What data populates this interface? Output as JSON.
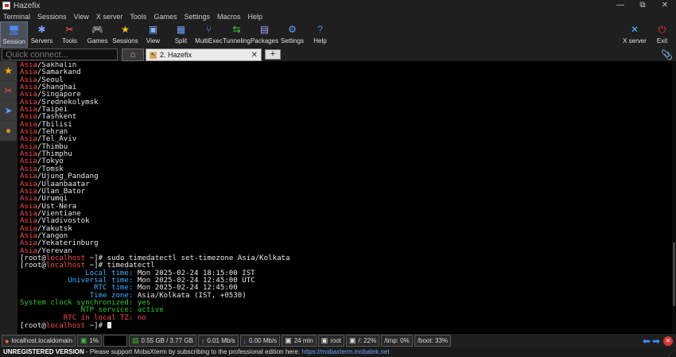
{
  "window": {
    "title": "Hazefix",
    "minimize": "—",
    "maximize": "⧉",
    "close": "✕"
  },
  "menu": [
    "Terminal",
    "Sessions",
    "View",
    "X server",
    "Tools",
    "Games",
    "Settings",
    "Macros",
    "Help"
  ],
  "toolbar": {
    "left": [
      {
        "label": "Session",
        "icon": "session-icon",
        "glyph": "🖥",
        "color": "#4a8cff"
      },
      {
        "label": "Servers",
        "icon": "servers-icon",
        "glyph": "✱",
        "color": "#7aa0ff"
      },
      {
        "label": "Tools",
        "icon": "tools-icon",
        "glyph": "✂",
        "color": "#ff6060"
      },
      {
        "label": "Games",
        "icon": "games-icon",
        "glyph": "🎮",
        "color": "#dddddd"
      },
      {
        "label": "Sessions",
        "icon": "star-icon",
        "glyph": "★",
        "color": "#ffc020"
      },
      {
        "label": "View",
        "icon": "view-icon",
        "glyph": "▣",
        "color": "#80b0ff"
      },
      {
        "label": "Split",
        "icon": "split-icon",
        "glyph": "▦",
        "color": "#6aa0ff"
      },
      {
        "label": "MultiExec",
        "icon": "multiexec-icon",
        "glyph": "⑂",
        "color": "#6a8cff"
      },
      {
        "label": "Tunneling",
        "icon": "tunneling-icon",
        "glyph": "⇆",
        "color": "#40d040"
      },
      {
        "label": "Packages",
        "icon": "packages-icon",
        "glyph": "▤",
        "color": "#a0a8ff"
      },
      {
        "label": "Settings",
        "icon": "gear-icon",
        "glyph": "⚙",
        "color": "#6a9cff"
      },
      {
        "label": "Help",
        "icon": "help-icon",
        "glyph": "?",
        "color": "#3a8cff"
      }
    ],
    "xserver": {
      "label": "X server",
      "icon": "xserver-icon",
      "glyph": "✕",
      "color": "#40c0ff"
    },
    "exit": {
      "label": "Exit",
      "icon": "power-icon",
      "glyph": "⏻",
      "color": "#ff3030"
    }
  },
  "tabs": {
    "quick_connect_placeholder": "Quick connect...",
    "home_glyph": "⌂",
    "active_tab_label": "2. Hazefix",
    "close_glyph": "✕",
    "new_tab_glyph": "+",
    "attach_glyph": "📎"
  },
  "sidebar": [
    {
      "icon": "star-icon",
      "glyph": "★",
      "color": "#ffb000"
    },
    {
      "icon": "tools-icon",
      "glyph": "✂",
      "color": "#ff5050"
    },
    {
      "icon": "send-icon",
      "glyph": "➤",
      "color": "#60a0ff"
    },
    {
      "icon": "macro-icon",
      "glyph": "●",
      "color": "#d09020"
    }
  ],
  "terminal": {
    "zones": [
      "Sakhalin",
      "Samarkand",
      "Seoul",
      "Shanghai",
      "Singapore",
      "Srednekolymsk",
      "Taipei",
      "Tashkent",
      "Tbilisi",
      "Tehran",
      "Tel_Aviv",
      "Thimbu",
      "Thimphu",
      "Tokyo",
      "Tomsk",
      "Ujung_Pandang",
      "Ulaanbaatar",
      "Ulan_Bator",
      "Urumqi",
      "Ust-Nera",
      "Vientiane",
      "Vladivostok",
      "Yakutsk",
      "Yangon",
      "Yekaterinburg",
      "Yerevan"
    ],
    "zone_prefix": "Asia",
    "prompt_user": "root",
    "prompt_host": "localhost",
    "prompt_dir": "~",
    "command1": "sudo timedatectl set-timezone Asia/Kolkata",
    "command2": "timedatectl",
    "info": [
      {
        "key": "               Local time",
        "value": "Mon 2025-02-24 18:15:00 IST",
        "key_color": "cyan",
        "val_color": "white"
      },
      {
        "key": "           Universal time",
        "value": "Mon 2025-02-24 12:45:00 UTC",
        "key_color": "cyan",
        "val_color": "white"
      },
      {
        "key": "                 RTC time",
        "value": "Mon 2025-02-24 12:45:00",
        "key_color": "cyan",
        "val_color": "white"
      },
      {
        "key": "                Time zone",
        "value": "Asia/Kolkata (IST, +0530)",
        "key_color": "cyan",
        "val_color": "white"
      },
      {
        "key": "System clock synchronized",
        "value": "yes",
        "key_color": "green",
        "val_color": "green"
      },
      {
        "key": "              NTP service",
        "value": "active",
        "key_color": "green",
        "val_color": "green"
      },
      {
        "key": "          RTC in local TZ",
        "value": "no",
        "key_color": "red",
        "val_color": "red"
      }
    ]
  },
  "status": {
    "host": "localhost.localdomain",
    "cpu": "1%",
    "memory": "0.55 GB / 3.77 GB",
    "upload": "0.01 Mb/s",
    "download": "0.00 Mb/s",
    "uptime": "24 min",
    "user": "root",
    "disk_root": "/: 22%",
    "disk_tmp": "/tmp: 0%",
    "disk_boot": "/boot: 33%"
  },
  "banner": {
    "unregistered": "UNREGISTERED VERSION",
    "message": "  -  Please support MobaXterm by subscribing to the professional edition here: ",
    "link": "https://mobaxterm.mobatek.net"
  }
}
